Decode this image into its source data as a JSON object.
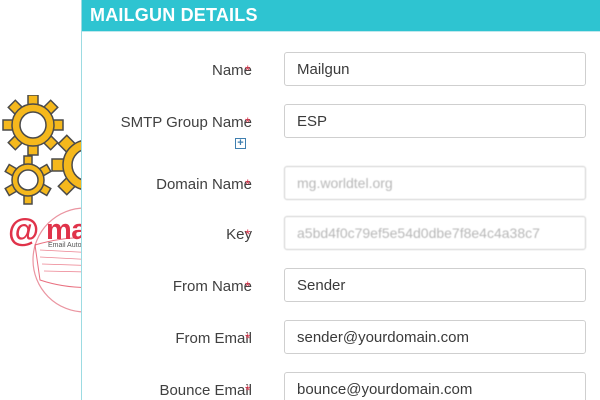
{
  "header": {
    "title": "MAILGUN DETAILS"
  },
  "brand": {
    "logo_text": "@mailgun",
    "logo_word": "mailgun",
    "logo_tagline": "Email Automation",
    "accent_color": "#2ec4d1",
    "logo_color": "#e0334a",
    "gear_color": "#f5b81c"
  },
  "form": {
    "required_marker": "*",
    "fields": [
      {
        "label": "Name",
        "value": "Mailgun"
      },
      {
        "label": "SMTP Group Name",
        "value": "ESP"
      },
      {
        "label": "Domain Name",
        "value": "mg.worldtel.org"
      },
      {
        "label": "Key",
        "value": "a5bd4f0c79ef5e54d0dbe7f8e4c4a38c7"
      },
      {
        "label": "From Name",
        "value": "Sender"
      },
      {
        "label": "From Email",
        "value": "sender@yourdomain.com"
      },
      {
        "label": "Bounce Email",
        "value": "bounce@yourdomain.com"
      }
    ],
    "add_group_icon": "plus-square-icon"
  }
}
